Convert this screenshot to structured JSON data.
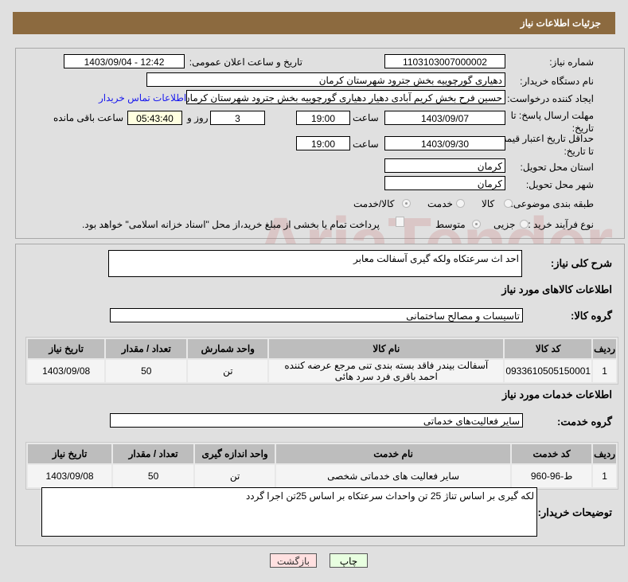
{
  "header": {
    "title": "جزئیات اطلاعات نیاز"
  },
  "form": {
    "need_number_label": "شماره نیاز:",
    "need_number": "1103103007000002",
    "announce_label": "تاریخ و ساعت اعلان عمومی:",
    "announce_value": "1403/09/04 - 12:42",
    "buyer_label": "نام دستگاه خریدار:",
    "buyer_value": "دهیاری گورچوییه بخش جترود شهرستان کرمان",
    "creator_label": "ایجاد کننده درخواست:",
    "creator_value": "حسین فرح بخش کریم آبادی دهیار دهیاری گورچوییه بخش جترود شهرستان کرمان",
    "contact_link": "اطلاعات تماس خریدار",
    "deadline_label": "مهلت ارسال پاسخ: تا تاریخ:",
    "deadline_date": "1403/09/07",
    "time_label": "ساعت",
    "deadline_time": "19:00",
    "days": "3",
    "days_label": "روز و",
    "remaining": "05:43:40",
    "remaining_label": "ساعت باقی مانده",
    "validity_label": "حداقل تاریخ اعتبار قیمت: تا تاریخ:",
    "validity_date": "1403/09/30",
    "validity_time": "19:00",
    "province_label": "استان محل تحویل:",
    "province": "کرمان",
    "city_label": "شهر محل تحویل:",
    "city": "کرمان",
    "category_label": "طبقه بندی موضوعی:",
    "category_options": [
      "کالا",
      "خدمت",
      "کالا/خدمت"
    ],
    "process_label": "نوع فرآیند خرید :",
    "process_options": [
      "جزیی",
      "متوسط"
    ],
    "payment_note": "پرداخت تمام یا بخشی از مبلغ خرید،از محل \"اسناد خزانه اسلامی\" خواهد بود."
  },
  "details": {
    "summary_label": "شرح کلی نیاز:",
    "summary": "احد اث سرعتکاه ولکه گیری آسفالت معابر",
    "goods_title": "اطلاعات کالاهای مورد نیاز",
    "goods_group_label": "گروه کالا:",
    "goods_group": "تاسیسات و مصالح ساختمانی",
    "goods_headers": [
      "ردیف",
      "کد کالا",
      "نام کالا",
      "واحد شمارش",
      "تعداد / مقدار",
      "تاریخ نیاز"
    ],
    "goods_rows": [
      [
        "1",
        "0933610505150001",
        "آسفالت بیندر فاقد بسته بندی تنی مرجع عرضه کننده احمد باقری فرد سرد هائی",
        "تن",
        "50",
        "1403/09/08"
      ]
    ],
    "services_title": "اطلاعات خدمات مورد نیاز",
    "service_group_label": "گروه خدمت:",
    "service_group": "سایر فعالیت‌های خدماتی",
    "service_headers": [
      "ردیف",
      "کد خدمت",
      "نام خدمت",
      "واحد اندازه گیری",
      "تعداد / مقدار",
      "تاریخ نیاز"
    ],
    "service_rows": [
      [
        "1",
        "ط-96-960",
        "سایر فعالیت های خدماتی شخصی",
        "تن",
        "50",
        "1403/09/08"
      ]
    ],
    "notes_label": "توضیحات خریدار:",
    "notes": "لکه گیری بر اساس تناژ 25 تن  واحداث سرعتکاه بر اساس 25تن اجرا گردد"
  },
  "buttons": {
    "print": "چاپ",
    "back": "بازگشت"
  },
  "watermark": "AriaTender.net"
}
